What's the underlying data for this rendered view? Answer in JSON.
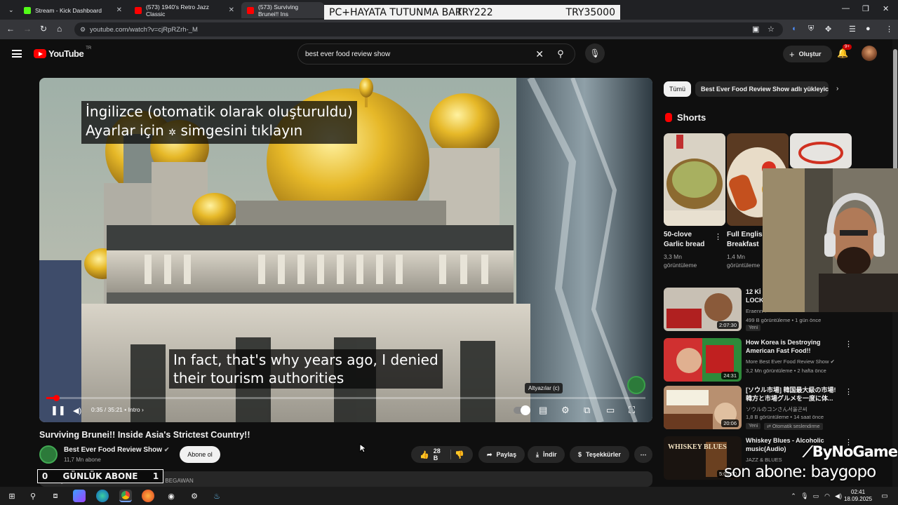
{
  "browser": {
    "tabs": [
      {
        "label": "Stream - Kick Dashboard",
        "color": "#53fc18"
      },
      {
        "label": "(573) 1940's Retro Jazz Classic",
        "color": "#ff0000"
      },
      {
        "label": "(573) Surviving Brunei!! Ins",
        "color": "#ff0000"
      }
    ],
    "url": "youtube.com/watch?v=cjRpRZrh-_M"
  },
  "overlay": {
    "text1": "PC+HAYATA TUTUNMA BARI",
    "text2": "TRY222",
    "text3": "TRY35000"
  },
  "yt": {
    "logo": "YouTube",
    "country": "TR",
    "search_value": "best ever food review show",
    "create_label": "Oluştur",
    "notif_count": "9+"
  },
  "player": {
    "caption_line1": "İngilizce (otomatik olarak oluşturuldu)",
    "caption_line2_a": "Ayarlar için",
    "caption_line2_b": "simgesini tıklayın",
    "subtitle_line1": "In fact, that's why years ago, I denied",
    "subtitle_line2": "their tourism authorities",
    "time": "0:35 / 35:21",
    "chapter": "• Intro",
    "tooltip": "Altyazılar (c)",
    "progress": 0.0165
  },
  "video": {
    "title": "Surviving Brunei!! Inside Asia's Strictest Country!!",
    "channel": "Best Ever Food Review Show",
    "subs": "11,7 Mn abone",
    "subscribe": "Abone ol",
    "likes": "28 B",
    "share": "Paylaş",
    "download": "İndir",
    "thanks": "Teşekkürler",
    "desc": "2 Mn görüntüleme 3 hafta önce BANDAR SERI BEGAWAN"
  },
  "daily": {
    "left": "0",
    "label": "GÜNLÜK ABONE",
    "right": "1"
  },
  "sidebar": {
    "chip_all": "Tümü",
    "chip_channel": "Best Ever Food Review Show adlı yükleyicinin",
    "shorts_label": "Shorts",
    "shorts": [
      {
        "title1": "50-clove",
        "title2": "Garlic bread",
        "views1": "3,3 Mn",
        "views2": "görüntüleme"
      },
      {
        "title1": "Full Englis",
        "title2": "Breakfast",
        "views1": "1,4 Mn",
        "views2": "görüntüleme"
      }
    ],
    "recs": [
      {
        "title1": "12 Kİ",
        "title2": "LOCK",
        "channel": "Eraenn",
        "meta": "499 B görüntüleme • 1 gün önce",
        "tag": "Yeni",
        "dur": "2:07:30"
      },
      {
        "title1": "How Korea is Destroying",
        "title2": "American Fast Food!!",
        "channel": "More Best Ever Food Review Show",
        "meta": "3,2 Mn görüntüleme • 2 hafta önce",
        "tag": "",
        "dur": "24:31"
      },
      {
        "title1": "[ソウル市場] 韓国最大級の市場!",
        "title2": "韓方と市場グルメを一度に体...",
        "channel": "ソウルのコンさん서울곤씨",
        "meta": "1,8 B görüntüleme • 14 saat önce",
        "tag": "Yeni",
        "tag2": "Otomatik seslendirme",
        "dur": "20:06"
      },
      {
        "title1": "Whiskey Blues - Alcoholic",
        "title2": "music(Audio)",
        "channel": "JAZZ & BLUES",
        "meta": "",
        "tag": "",
        "dur": "5:05:00"
      }
    ]
  },
  "stream": {
    "brand": "ByNoGame",
    "last_sub": "son abone: baygopo"
  },
  "taskbar": {
    "time": "02:41",
    "date": "18.09.2025"
  }
}
